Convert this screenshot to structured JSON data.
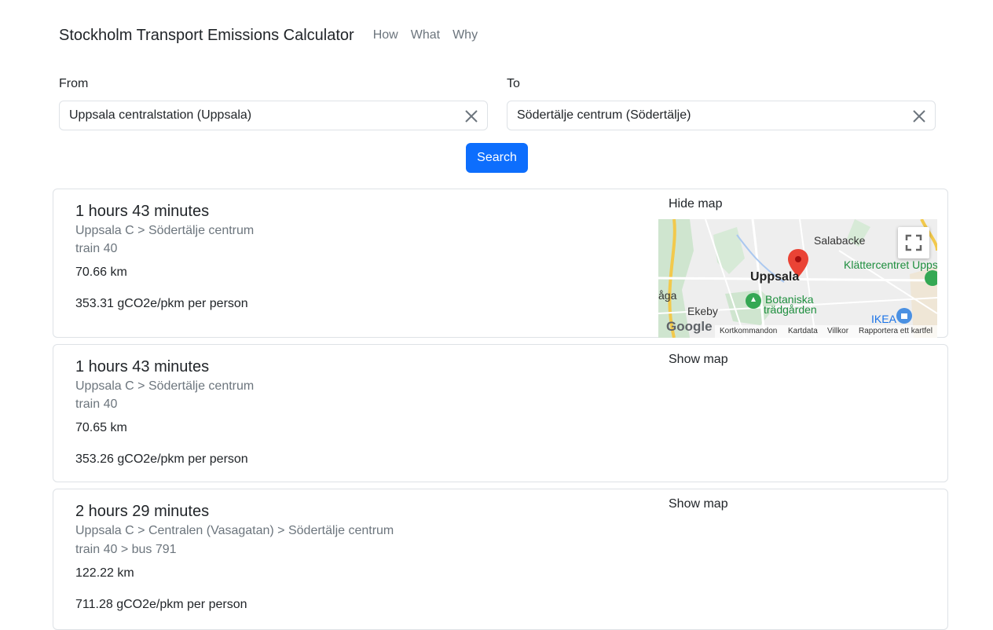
{
  "app": {
    "title": "Stockholm Transport Emissions Calculator",
    "nav": [
      "How",
      "What",
      "Why"
    ]
  },
  "form": {
    "from_label": "From",
    "from_value": "Uppsala centralstation (Uppsala)",
    "to_label": "To",
    "to_value": "Södertälje centrum (Södertälje)",
    "search_label": "Search"
  },
  "results": [
    {
      "duration": "1 hours 43 minutes",
      "route": "Uppsala C > Södertälje centrum",
      "lines": "train 40",
      "distance": "70.66 km",
      "emissions": "353.31 gCO2e/pkm per person",
      "map_toggle": "Hide map"
    },
    {
      "duration": "1 hours 43 minutes",
      "route": "Uppsala C > Södertälje centrum",
      "lines": "train 40",
      "distance": "70.65 km",
      "emissions": "353.26 gCO2e/pkm per person",
      "map_toggle": "Show map"
    },
    {
      "duration": "2 hours 29 minutes",
      "route": "Uppsala C > Centralen (Vasagatan) > Södertälje centrum",
      "lines": "train 40 > bus 791",
      "distance": "122.22 km",
      "emissions": "711.28 gCO2e/pkm per person",
      "map_toggle": "Show map"
    }
  ],
  "map": {
    "places": [
      "Salabacke",
      "Uppsala",
      "Klättercentret Upps",
      "Botaniska",
      "trädgården",
      "Ekeby",
      "IKEA",
      "åga"
    ],
    "logo": "Google",
    "footer": [
      "Kortkommandon",
      "Kartdata",
      "Villkor",
      "Rapportera ett kartfel"
    ]
  },
  "colors": {
    "primary": "#0d6efd",
    "muted": "#6c757d",
    "border": "#dee2e6",
    "marker": "#ea4335",
    "park": "#c8e6c9"
  },
  "icons": {
    "clear": "close-icon",
    "fullscreen": "fullscreen-icon",
    "marker": "map-marker-icon"
  }
}
